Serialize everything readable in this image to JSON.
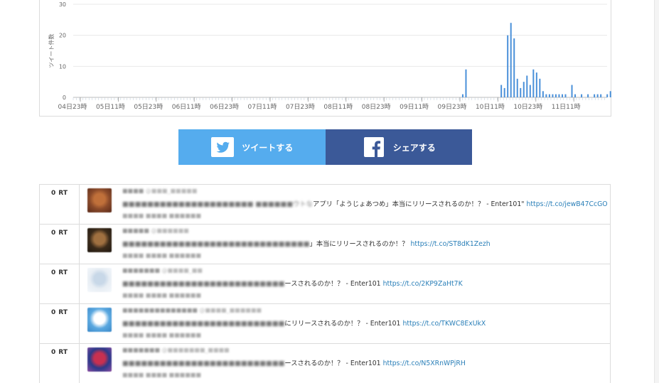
{
  "chart_data": {
    "type": "bar",
    "ylabel": "ツイート件数",
    "yticks": [
      0,
      10,
      20,
      30
    ],
    "ylim": [
      0,
      30
    ],
    "xtick_labels": [
      "04日23時",
      "05日11時",
      "05日23時",
      "06日11時",
      "06日23時",
      "07日11時",
      "07日23時",
      "08日11時",
      "08日23時",
      "09日11時",
      "09日23時",
      "10日11時",
      "10日23時",
      "11日11時"
    ],
    "series": [
      {
        "hour_offsets": [
          0,
          0.5,
          6,
          6.5,
          7,
          7.5,
          8,
          8.5,
          9,
          9.5,
          10,
          10.5,
          11,
          11.5,
          12,
          12.5,
          13,
          13.5,
          14,
          14.5,
          15,
          15.5,
          16,
          17,
          17.5,
          18.5,
          19.5,
          20.5,
          21,
          21.5,
          22.5,
          23,
          23.5
        ],
        "values": [
          1,
          9,
          4,
          3,
          20,
          24,
          19,
          6,
          3,
          5,
          7,
          4,
          9,
          8,
          6,
          2,
          1,
          1,
          1,
          1,
          1,
          1,
          1,
          4,
          1,
          1,
          1,
          1,
          1,
          1,
          1,
          2,
          1
        ]
      }
    ]
  },
  "share": {
    "tweet_label": "ツイートする",
    "share_label": "シェアする"
  },
  "tweets": [
    {
      "rt_count": "0",
      "rt_label": "RT",
      "user": "■■■■",
      "handle": "@■■■_■■■■■",
      "blurred_text": "■■■■■■■■■■■■■■■■■■■■■ ■■■■■■ウトな",
      "text": "アプリ「ようじょあつめ」本当にリリースされるのか！？ - Enter101\"",
      "link": "https://t.co/jewB47CcGO",
      "date": "■■■■ ■■■■ ■■■■■■",
      "avatar_colors": [
        "#8a4a2a",
        "#c0703a",
        "#5a2a18"
      ]
    },
    {
      "rt_count": "0",
      "rt_label": "RT",
      "user": "■■■■■",
      "handle": "@■■■■■■",
      "blurred_text": "■■■■■■■■■■■■■■■■■■■■■■■■■■■■■■",
      "text": "」本当にリリースされるのか！？",
      "link": "https://t.co/ST8dK1Zezh",
      "date": "■■■■ ■■■■ ■■■■■■",
      "avatar_colors": [
        "#3a2a1a",
        "#a07040",
        "#201810"
      ]
    },
    {
      "rt_count": "0",
      "rt_label": "RT",
      "user": "■■■■■■■",
      "handle": "@■■■■_■■",
      "blurred_text": "■■■■■■■■■■■■■■■■■■■■■■■■■■",
      "text": "ースされるのか！？ - Enter101",
      "link": "https://t.co/2KP9ZaHt7K",
      "date": "■■■■ ■■■■ ■■■■■■",
      "avatar_colors": [
        "#e8eef4",
        "#c8d8e8",
        "#f4f8fc"
      ]
    },
    {
      "rt_count": "0",
      "rt_label": "RT",
      "user": "■■■■■■■■■■■■■■",
      "handle": "@■■■■_■■■■■■",
      "blurred_text": "■■■■■■■■■■■■■■■■■■■■■■■■■■",
      "text": "にリリースされるのか！？ - Enter101",
      "link": "https://t.co/TKWC8ExUkX",
      "date": "■■■■ ■■■■ ■■■■■■",
      "avatar_colors": [
        "#5aa8e0",
        "#ffffff",
        "#3a88c8"
      ]
    },
    {
      "rt_count": "0",
      "rt_label": "RT",
      "user": "■■■■■■■",
      "handle": "@■■■■■■■_■■■■",
      "blurred_text": "■■■■■■■■■■■■■■■■■■■■■■■■■■",
      "text": "ースされるのか！？ - Enter101",
      "link": "https://t.co/N5XRnWPjRH",
      "date": "■■■■ ■■■■ ■■■■■■",
      "avatar_colors": [
        "#2a3a8a",
        "#c83050",
        "#8a4aa0"
      ]
    }
  ]
}
